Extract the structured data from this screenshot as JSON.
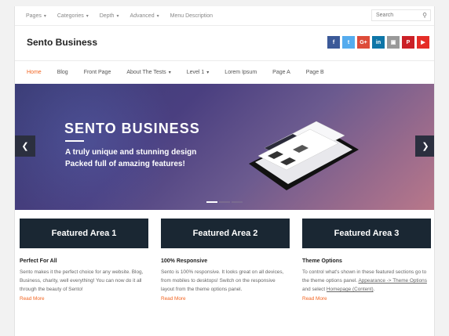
{
  "topbar": {
    "items": [
      "Pages",
      "Categories",
      "Depth",
      "Advanced",
      "Menu Description"
    ],
    "search_placeholder": "Search"
  },
  "header": {
    "site_title": "Sento Business",
    "social": [
      {
        "label": "f",
        "color": "#3b5998"
      },
      {
        "label": "t",
        "color": "#55acee"
      },
      {
        "label": "G+",
        "color": "#dd4b39"
      },
      {
        "label": "in",
        "color": "#0e76a8"
      },
      {
        "label": "▣",
        "color": "#999999"
      },
      {
        "label": "P",
        "color": "#cb2027"
      },
      {
        "label": "▶",
        "color": "#e52d27"
      }
    ]
  },
  "nav": {
    "items": [
      "Home",
      "Blog",
      "Front Page",
      "About The Tests",
      "Level 1",
      "Lorem Ipsum",
      "Page A",
      "Page B"
    ]
  },
  "slider": {
    "title": "SENTO BUSINESS",
    "line1": "A truly unique and stunning design",
    "line2": "Packed full of amazing features!",
    "prev": "❮",
    "next": "❯"
  },
  "features": [
    {
      "box": "Featured Area 1",
      "heading": "Perfect For All",
      "text": "Sento makes it the perfect choice for any website. Blog, Business, charity, well everything! You can now do it all through the beauty of Sento!",
      "readmore": "Read More"
    },
    {
      "box": "Featured Area 2",
      "heading": "100% Responsive",
      "text": "Sento is 100% responsive. It looks great on all devices, from mobiles to desktops! Switch on the responsive layout from the theme options panel.",
      "readmore": "Read More"
    },
    {
      "box": "Featured Area 3",
      "heading": "Theme Options",
      "text_a": "To control what's shown in these featured sections go to the theme options panel.",
      "link1": "Appearance -> Theme Options",
      "text_b": "and select",
      "link2": "Homepage (Content)",
      "text_c": ".",
      "readmore": "Read More"
    }
  ],
  "colors": {
    "accent": "#f26522",
    "feature_bg": "#1a2733"
  }
}
